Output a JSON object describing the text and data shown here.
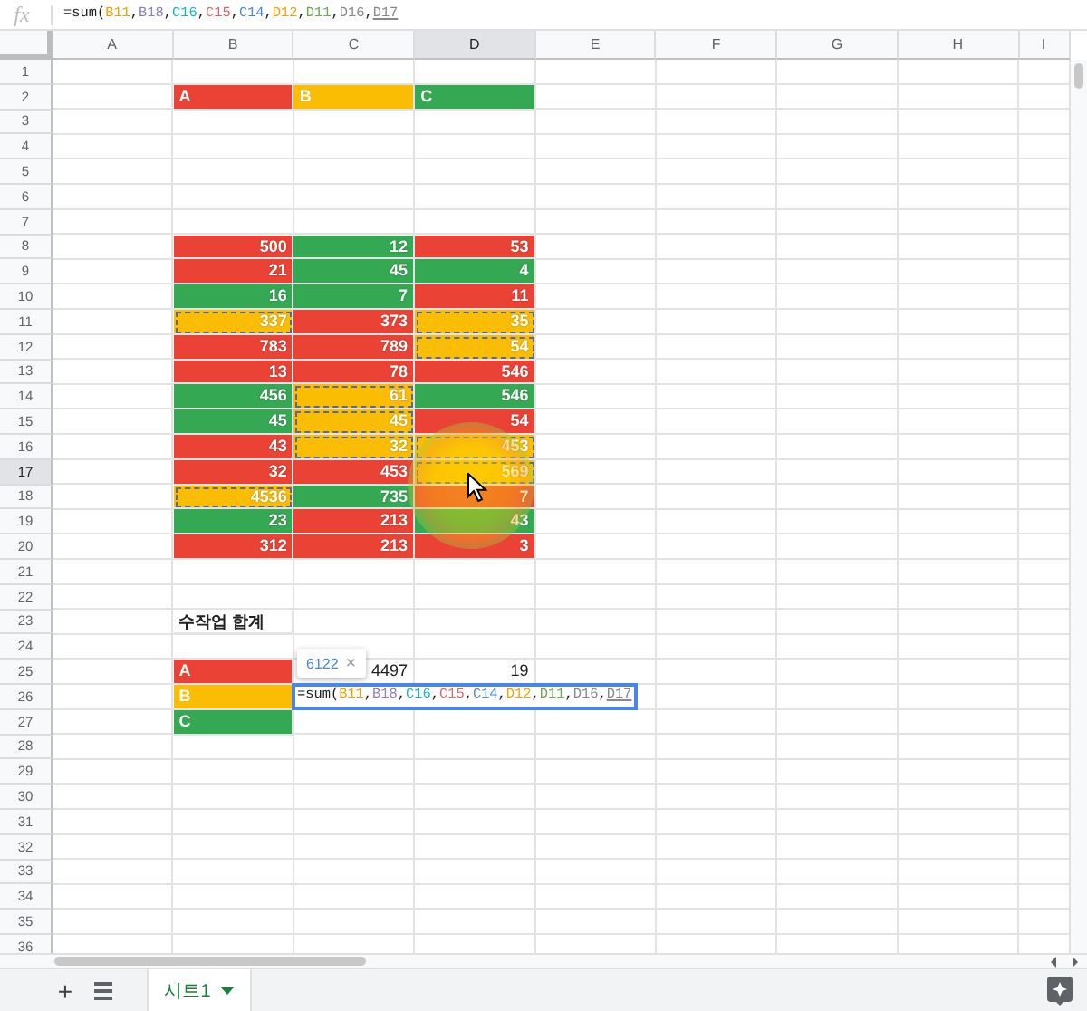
{
  "formula_bar": {
    "fx": "fx",
    "formula": [
      {
        "text": "=sum(",
        "underlined": false
      },
      {
        "text": "B11",
        "color": "#f4a000",
        "underlined": false
      },
      {
        "text": ",",
        "underlined": false
      },
      {
        "text": "B18",
        "color": "#8e7cc3",
        "underlined": false
      },
      {
        "text": ",",
        "underlined": false
      },
      {
        "text": "C16",
        "color": "#12b5cb",
        "underlined": false
      },
      {
        "text": ",",
        "underlined": false
      },
      {
        "text": "C15",
        "color": "#e06666",
        "underlined": false
      },
      {
        "text": ",",
        "underlined": false
      },
      {
        "text": "C14",
        "color": "#4a86e8",
        "underlined": false
      },
      {
        "text": ",",
        "underlined": false
      },
      {
        "text": "D12",
        "color": "#f1a208",
        "underlined": false
      },
      {
        "text": ",",
        "underlined": false
      },
      {
        "text": "D11",
        "color": "#6aa84f",
        "underlined": false
      },
      {
        "text": ",",
        "underlined": false
      },
      {
        "text": "D16",
        "color": "#888888",
        "underlined": false
      },
      {
        "text": ",",
        "underlined": false
      },
      {
        "text": "D17",
        "color": "#888888",
        "underlined": true
      }
    ]
  },
  "columns": [
    {
      "label": "A",
      "selected": false
    },
    {
      "label": "B",
      "selected": false
    },
    {
      "label": "C",
      "selected": false
    },
    {
      "label": "D",
      "selected": true
    },
    {
      "label": "E",
      "selected": false
    },
    {
      "label": "F",
      "selected": false
    },
    {
      "label": "G",
      "selected": false
    },
    {
      "label": "H",
      "selected": false
    },
    {
      "label": "I",
      "selected": false
    }
  ],
  "sheet_rows": [
    {
      "header": "1",
      "selected": false,
      "cells": []
    },
    {
      "header": "2",
      "selected": false,
      "cells": [
        {},
        {
          "text": "A",
          "kind": "label",
          "color": "#ea4335"
        },
        {
          "text": "B",
          "kind": "label",
          "color": "#fbbc04"
        },
        {
          "text": "C",
          "kind": "label",
          "color": "#34a853"
        }
      ]
    },
    {
      "header": "3",
      "selected": false,
      "cells": []
    },
    {
      "header": "4",
      "selected": false,
      "cells": []
    },
    {
      "header": "5",
      "selected": false,
      "cells": []
    },
    {
      "header": "6",
      "selected": false,
      "cells": []
    },
    {
      "header": "7",
      "selected": false,
      "cells": []
    },
    {
      "header": "8",
      "selected": false,
      "cells": [
        {},
        {
          "text": "500",
          "kind": "number",
          "color": "#ea4335"
        },
        {
          "text": "12",
          "kind": "number",
          "color": "#34a853"
        },
        {
          "text": "53",
          "kind": "number",
          "color": "#ea4335"
        }
      ]
    },
    {
      "header": "9",
      "selected": false,
      "cells": [
        {},
        {
          "text": "21",
          "kind": "number",
          "color": "#ea4335"
        },
        {
          "text": "45",
          "kind": "number",
          "color": "#34a853"
        },
        {
          "text": "4",
          "kind": "number",
          "color": "#34a853"
        }
      ]
    },
    {
      "header": "10",
      "selected": false,
      "cells": [
        {},
        {
          "text": "16",
          "kind": "number",
          "color": "#34a853"
        },
        {
          "text": "7",
          "kind": "number",
          "color": "#34a853"
        },
        {
          "text": "11",
          "kind": "number",
          "color": "#ea4335"
        }
      ]
    },
    {
      "header": "11",
      "selected": false,
      "cells": [
        {},
        {
          "text": "337",
          "kind": "number",
          "color": "#fbbc04",
          "referenced": true
        },
        {
          "text": "373",
          "kind": "number",
          "color": "#ea4335"
        },
        {
          "text": "35",
          "kind": "number",
          "color": "#fbbc04",
          "referenced": true
        }
      ]
    },
    {
      "header": "12",
      "selected": false,
      "cells": [
        {},
        {
          "text": "783",
          "kind": "number",
          "color": "#ea4335"
        },
        {
          "text": "789",
          "kind": "number",
          "color": "#ea4335"
        },
        {
          "text": "54",
          "kind": "number",
          "color": "#fbbc04",
          "referenced": true
        }
      ]
    },
    {
      "header": "13",
      "selected": false,
      "cells": [
        {},
        {
          "text": "13",
          "kind": "number",
          "color": "#ea4335"
        },
        {
          "text": "78",
          "kind": "number",
          "color": "#ea4335"
        },
        {
          "text": "546",
          "kind": "number",
          "color": "#ea4335"
        }
      ]
    },
    {
      "header": "14",
      "selected": false,
      "cells": [
        {},
        {
          "text": "456",
          "kind": "number",
          "color": "#34a853"
        },
        {
          "text": "61",
          "kind": "number",
          "color": "#fbbc04",
          "referenced": true
        },
        {
          "text": "546",
          "kind": "number",
          "color": "#34a853"
        }
      ]
    },
    {
      "header": "15",
      "selected": false,
      "cells": [
        {},
        {
          "text": "45",
          "kind": "number",
          "color": "#34a853"
        },
        {
          "text": "45",
          "kind": "number",
          "color": "#fbbc04",
          "referenced": true
        },
        {
          "text": "54",
          "kind": "number",
          "color": "#ea4335"
        }
      ]
    },
    {
      "header": "16",
      "selected": false,
      "cells": [
        {},
        {
          "text": "43",
          "kind": "number",
          "color": "#ea4335"
        },
        {
          "text": "32",
          "kind": "number",
          "color": "#fbbc04",
          "referenced": true
        },
        {
          "text": "453",
          "kind": "number",
          "color": "#fbbc04",
          "referenced": true
        }
      ]
    },
    {
      "header": "17",
      "selected": true,
      "cells": [
        {},
        {
          "text": "32",
          "kind": "number",
          "color": "#ea4335"
        },
        {
          "text": "453",
          "kind": "number",
          "color": "#ea4335"
        },
        {
          "text": "569",
          "kind": "number",
          "color": "#fbbc04",
          "referenced": true
        }
      ]
    },
    {
      "header": "18",
      "selected": false,
      "cells": [
        {},
        {
          "text": "4536",
          "kind": "number",
          "color": "#fbbc04",
          "referenced": true
        },
        {
          "text": "735",
          "kind": "number",
          "color": "#34a853"
        },
        {
          "text": "7",
          "kind": "number",
          "color": "#ea4335"
        }
      ]
    },
    {
      "header": "19",
      "selected": false,
      "cells": [
        {},
        {
          "text": "23",
          "kind": "number",
          "color": "#34a853"
        },
        {
          "text": "213",
          "kind": "number",
          "color": "#ea4335"
        },
        {
          "text": "43",
          "kind": "number",
          "color": "#34a853"
        }
      ]
    },
    {
      "header": "20",
      "selected": false,
      "cells": [
        {},
        {
          "text": "312",
          "kind": "number",
          "color": "#ea4335"
        },
        {
          "text": "213",
          "kind": "number",
          "color": "#ea4335"
        },
        {
          "text": "3",
          "kind": "number",
          "color": "#ea4335"
        }
      ]
    },
    {
      "header": "21",
      "selected": false,
      "cells": []
    },
    {
      "header": "22",
      "selected": false,
      "cells": []
    },
    {
      "header": "23",
      "selected": false,
      "cells": [
        {},
        {
          "text": "수작업 합계",
          "kind": "title"
        }
      ]
    },
    {
      "header": "24",
      "selected": false,
      "cells": []
    },
    {
      "header": "25",
      "selected": false,
      "cells": [
        {},
        {
          "text": "A",
          "kind": "label",
          "color": "#ea4335"
        },
        {
          "text": "4497",
          "kind": "plain_number"
        },
        {
          "text": "19",
          "kind": "plain_number"
        }
      ]
    },
    {
      "header": "26",
      "selected": false,
      "cells": [
        {},
        {
          "text": "B",
          "kind": "label",
          "color": "#fbbc04"
        }
      ]
    },
    {
      "header": "27",
      "selected": false,
      "cells": [
        {},
        {
          "text": "C",
          "kind": "label",
          "color": "#34a853"
        }
      ]
    },
    {
      "header": "28",
      "selected": false,
      "cells": []
    },
    {
      "header": "29",
      "selected": false,
      "cells": []
    },
    {
      "header": "30",
      "selected": false,
      "cells": []
    },
    {
      "header": "31",
      "selected": false,
      "cells": []
    },
    {
      "header": "32",
      "selected": false,
      "cells": []
    },
    {
      "header": "33",
      "selected": false,
      "cells": []
    },
    {
      "header": "34",
      "selected": false,
      "cells": []
    },
    {
      "header": "35",
      "selected": false,
      "cells": []
    },
    {
      "header": "36",
      "selected": false,
      "cells": []
    }
  ],
  "preview_tooltip": {
    "value": "6122",
    "close": "×"
  },
  "cell_editor": {
    "formula": [
      {
        "text": "=sum(",
        "underlined": false
      },
      {
        "text": "B11",
        "color": "#f4a000",
        "underlined": false
      },
      {
        "text": ",",
        "underlined": false
      },
      {
        "text": "B18",
        "color": "#8e7cc3",
        "underlined": false
      },
      {
        "text": ",",
        "underlined": false
      },
      {
        "text": "C16",
        "color": "#12b5cb",
        "underlined": false
      },
      {
        "text": ",",
        "underlined": false
      },
      {
        "text": "C15",
        "color": "#e06666",
        "underlined": false
      },
      {
        "text": ",",
        "underlined": false
      },
      {
        "text": "C14",
        "color": "#4a86e8",
        "underlined": false
      },
      {
        "text": ",",
        "underlined": false
      },
      {
        "text": "D12",
        "color": "#f1a208",
        "underlined": false
      },
      {
        "text": ",",
        "underlined": false
      },
      {
        "text": "D11",
        "color": "#6aa84f",
        "underlined": false
      },
      {
        "text": ",",
        "underlined": false
      },
      {
        "text": "D16",
        "color": "#888888",
        "underlined": false
      },
      {
        "text": ",",
        "underlined": false
      },
      {
        "text": "D17",
        "color": "#888888",
        "underlined": true
      }
    ]
  },
  "bottom_bar": {
    "add": "+",
    "tabs": [
      {
        "label": "시트1",
        "selected": true
      }
    ]
  }
}
